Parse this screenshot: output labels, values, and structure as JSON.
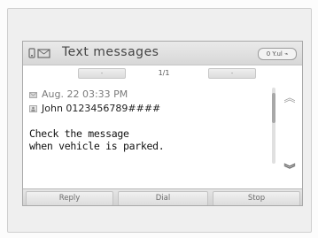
{
  "header": {
    "title": "Text messages",
    "signal_text": "0 Y.ul ⌁",
    "icons": [
      "phone-icon",
      "message-icon"
    ]
  },
  "pager": {
    "prev_label": "-",
    "next_label": "-",
    "page_indicator": "1/1"
  },
  "message": {
    "date": "Aug. 22 03:33 PM",
    "sender": "John 0123456789####",
    "body_line1": "Check the message",
    "body_line2": "when vehicle is parked."
  },
  "scroll": {
    "up_icon": "chevron-double-up-icon",
    "down_icon": "chevron-double-down-icon",
    "up_glyph": "︽",
    "down_glyph": "︾"
  },
  "buttons": {
    "reply": "Reply",
    "dial": "Dial",
    "stop": "Stop"
  },
  "colors": {
    "screen_background": "#ffffff",
    "bar_background": "#d7d7d7",
    "text": "#222222"
  }
}
